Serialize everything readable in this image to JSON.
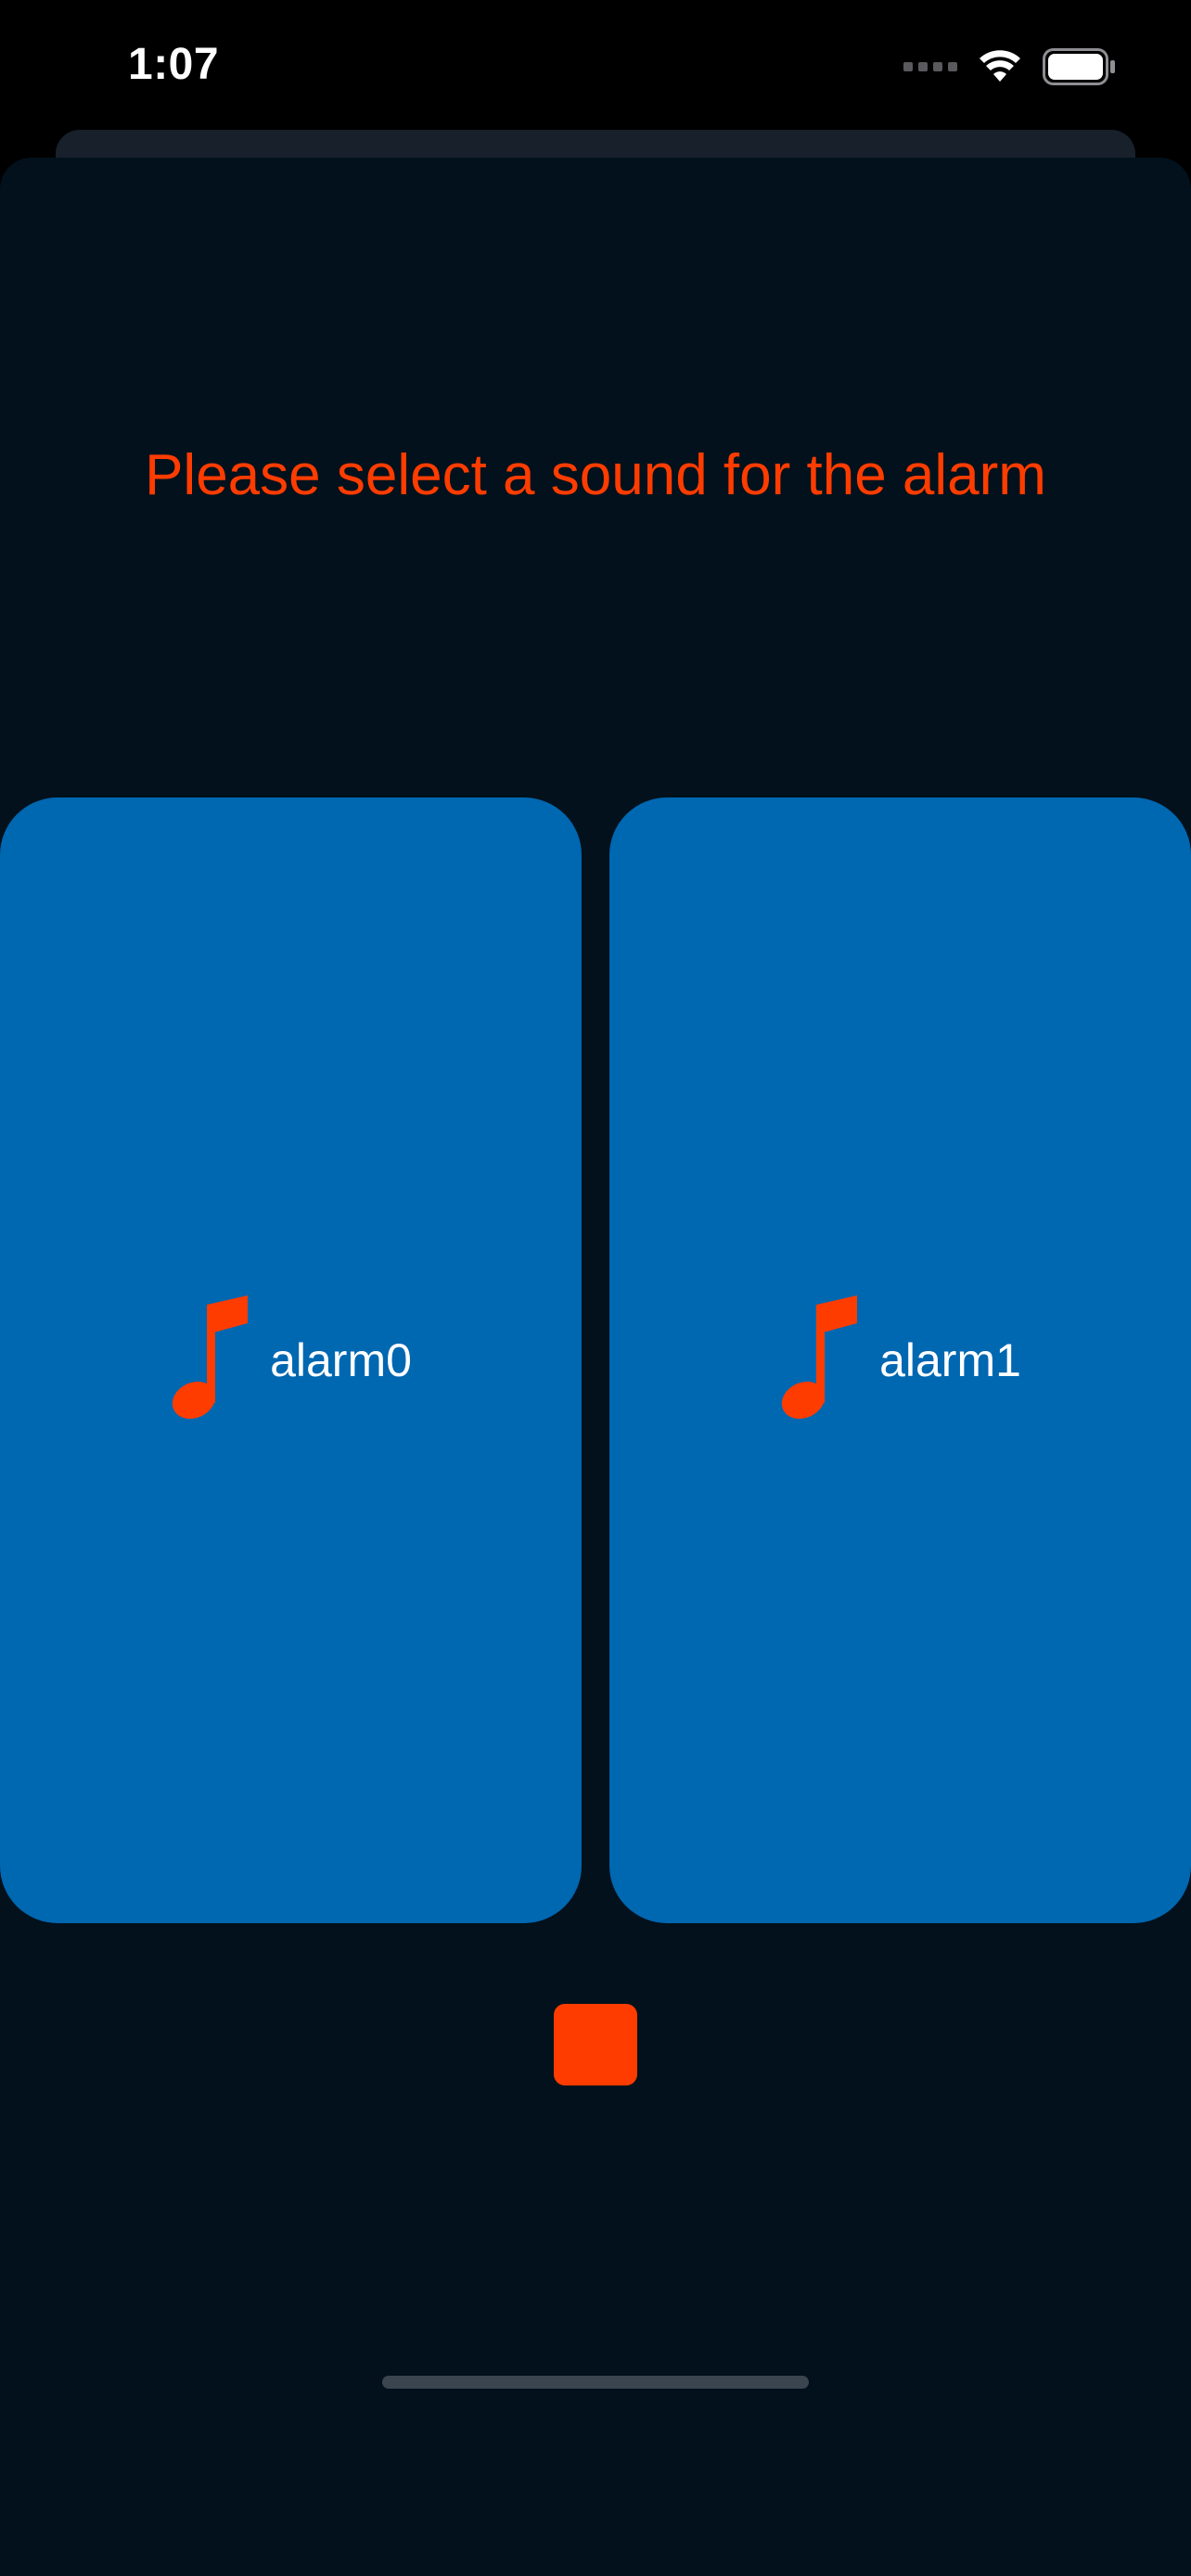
{
  "status_bar": {
    "time": "1:07",
    "icons": [
      "signal-icon",
      "wifi-icon",
      "battery-icon"
    ]
  },
  "sheet": {
    "prompt": "Please select a sound for the alarm"
  },
  "sounds": [
    {
      "label": "alarm0",
      "icon": "music-note-icon"
    },
    {
      "label": "alarm1",
      "icon": "music-note-icon"
    }
  ],
  "controls": {
    "stop_icon": "stop-icon"
  },
  "colors": {
    "background": "#02111c",
    "accent": "#ff3c00",
    "card": "#0067b1",
    "text": "#ffffff"
  }
}
